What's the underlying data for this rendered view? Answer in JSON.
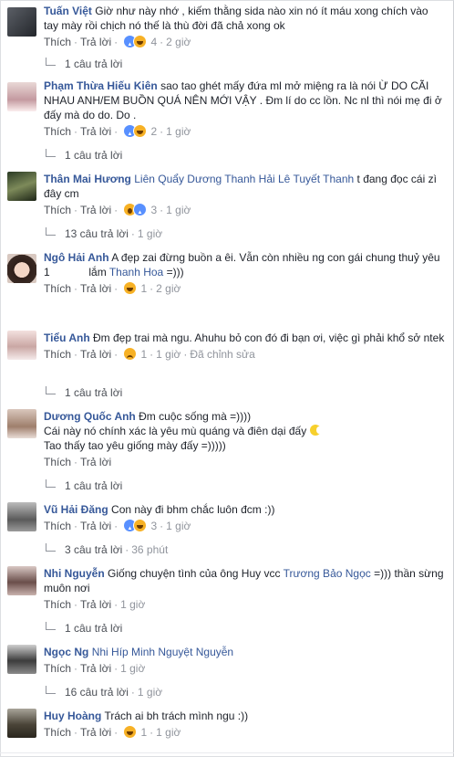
{
  "colors": {
    "link": "#365899",
    "meta": "#90949c",
    "text": "#1d2129"
  },
  "comments": [
    {
      "author": "Tuấn Việt",
      "text": "Giờ như này nhớ , kiếm thằng sida nào xin nó ít máu xong chích vào tay mày rồi chịch nó thế là thù đời đã chả xong ok",
      "like": "Thích",
      "reply": "Trả lời",
      "reactions": "4",
      "time": "2 giờ",
      "replies": "1 câu trả lời"
    },
    {
      "author": "Phạm Thừa Hiếu Kiên",
      "text": "sao tao ghét mấy đứa ml mở miệng ra là nói Ừ DO CÃI NHAU ANH/EM BUỒN QUÁ NÊN MỚI VẬY . Đm lí do cc lồn. Nc nl thì nói mẹ đi ở đấy mà do do. Do .",
      "like": "Thích",
      "reply": "Trả lời",
      "reactions": "2",
      "time": "1 giờ",
      "replies": "1 câu trả lời"
    },
    {
      "author": "Thân Mai Hương",
      "tags": "Liên Quẩy Dương Thanh Hải Lê Tuyết Thanh",
      "text": "t đang đọc cái zì đây cm",
      "like": "Thích",
      "reply": "Trả lời",
      "reactions": "3",
      "time": "1 giờ",
      "replies": "13 câu trả lời",
      "replies_time": "1 giờ"
    },
    {
      "author": "Ngô Hải Anh",
      "text": "A đẹp zai đừng buồn a êi. Vẫn còn nhiều ng con gái chung thuỷ yêu 1",
      "text2": "lắm",
      "tag_end": "Thanh Hoa",
      "text3": "=)))",
      "like": "Thích",
      "reply": "Trả lời",
      "reactions": "1",
      "time": "2 giờ"
    },
    {
      "author": "Tiểu Anh",
      "text": "Đm đẹp trai mà ngu. Ahuhu bỏ con đó đi bạn ơi, việc gì phải khổ sở ntek",
      "like": "Thích",
      "reply": "Trả lời",
      "reactions": "1",
      "time": "1 giờ",
      "edited": "Đã chỉnh sửa",
      "replies": "1 câu trả lời"
    },
    {
      "author": "Dương Quốc Anh",
      "text": "Đm cuộc sống mà =))))",
      "line2": "Cái này nó chính xác là yêu mù quáng và điên dại đấy",
      "line3": "Tao thấy tao yêu giống mày đấy =)))))",
      "like": "Thích",
      "reply": "Trả lời",
      "replies": "1 câu trả lời"
    },
    {
      "author": "Vũ Hải Đăng",
      "text": "Con này đi bhm chắc luôn đcm :))",
      "like": "Thích",
      "reply": "Trả lời",
      "reactions": "3",
      "time": "1 giờ",
      "replies": "3 câu trả lời",
      "replies_time": "36 phút"
    },
    {
      "author": "Nhi Nguyễn",
      "text": "Giống chuyện tình của ông Huy vcc",
      "tag_end": "Trương Bảo Ngọc",
      "text3": "=))) thần sừng muôn nơi",
      "like": "Thích",
      "reply": "Trả lời",
      "time": "1 giờ",
      "replies": "1 câu trả lời"
    },
    {
      "author": "Ngọc Ng",
      "tags": "Nhi Híp Minh Nguyệt Nguyễn",
      "like": "Thích",
      "reply": "Trả lời",
      "time": "1 giờ",
      "replies": "16 câu trả lời",
      "replies_time": "1 giờ"
    },
    {
      "author": "Huy Hoàng",
      "text": "Trách ai bh trách mình ngu :))",
      "like": "Thích",
      "reply": "Trả lời",
      "reactions": "1",
      "time": "1 giờ"
    }
  ]
}
